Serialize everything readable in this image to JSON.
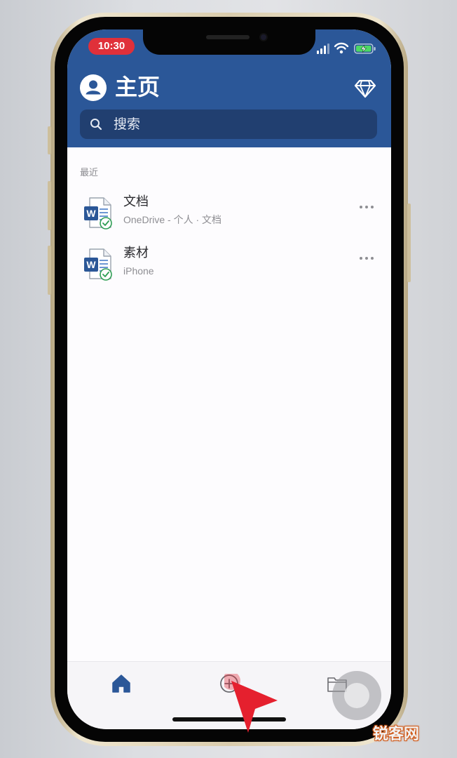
{
  "status_bar": {
    "time": "10:30"
  },
  "header": {
    "title": "主页"
  },
  "search": {
    "placeholder": "搜索"
  },
  "recent": {
    "label": "最近",
    "items": [
      {
        "name": "文档",
        "subtitle": "OneDrive - 个人 · 文档",
        "icon": "word-document-icon"
      },
      {
        "name": "素材",
        "subtitle": "iPhone",
        "icon": "word-document-icon"
      }
    ]
  },
  "tabbar": {
    "tabs": [
      {
        "icon": "home-icon",
        "selected": true
      },
      {
        "icon": "add-icon",
        "selected": false
      },
      {
        "icon": "folder-icon",
        "selected": false
      }
    ]
  },
  "colors": {
    "header": "#2b5798",
    "search_bg": "#213f70",
    "word_blue": "#2b5797",
    "time_pill": "#e0303a",
    "cursor": "#e5202e"
  },
  "watermark": "锐客网"
}
